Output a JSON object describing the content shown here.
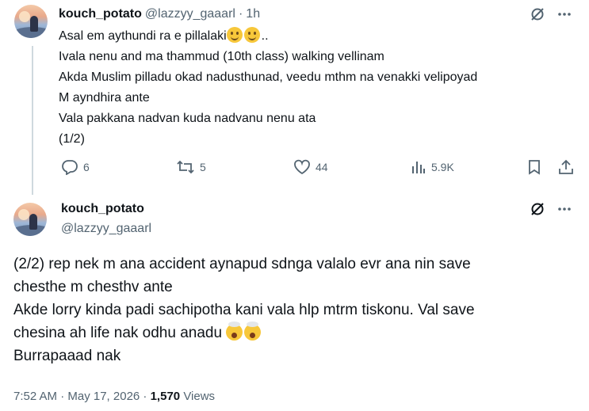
{
  "tweet1": {
    "display_name": "kouch_potato",
    "handle": "@lazzyy_gaaarl",
    "separator": "·",
    "time": "1h",
    "lines": [
      "Asal em aythundi ra e pillalaki",
      "Ivala nenu and ma thammud (10th class) walking vellinam",
      "Akda Muslim pilladu okad nadusthunad, veedu mthm na venakki velipoyad",
      "M ayndhira ante",
      "Vala pakkana nadvan kuda nadvanu nenu ata",
      "(1/2)"
    ],
    "line1_suffix": "..",
    "line1_emojis": [
      "slightly-smiling-face",
      "slightly-smiling-face"
    ],
    "stats": {
      "replies": "6",
      "reposts": "5",
      "likes": "44",
      "views": "5.9K"
    }
  },
  "tweet2": {
    "display_name": "kouch_potato",
    "handle": "@lazzyy_gaaarl",
    "lines": [
      "(2/2) rep nek m ana accident aynapud sdnga valalo evr ana nin save",
      "chesthe m chesthv ante",
      "Akde lorry kinda padi sachipotha kani vala hlp mtrm tiskonu. Val save",
      "chesina ah life nak odhu anadu",
      "Burrapaaad nak"
    ],
    "line4_emojis": [
      "exploding-head",
      "exploding-head"
    ],
    "timestamp": "7:52 AM · May 17, 2026 ·",
    "views_count": "1,570",
    "views_label": "Views"
  },
  "colors": {
    "text_primary": "#0f1419",
    "text_secondary": "#536471",
    "thread_line": "#cfd9de",
    "background": "#ffffff"
  }
}
